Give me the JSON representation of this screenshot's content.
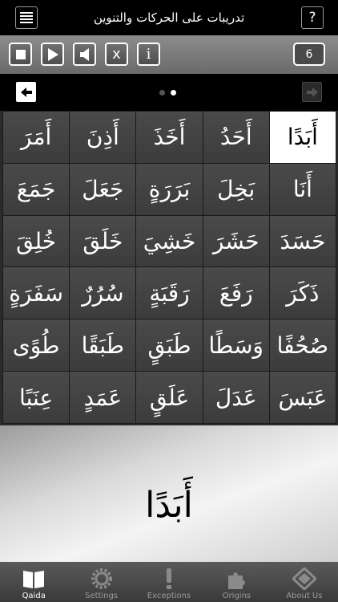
{
  "header": {
    "title": "تدريبات على الحركات والتنوين",
    "menu_icon": "menu-icon",
    "help_label": "?"
  },
  "toolbar": {
    "stop_icon": "stop-icon",
    "play_icon": "play-icon",
    "speaker_icon": "speaker-icon",
    "close_label": "x",
    "info_label": "i",
    "counter": "6"
  },
  "nav": {
    "prev_icon": "arrow-left-icon",
    "next_icon": "arrow-right-icon",
    "pages": 2,
    "current_page": 2
  },
  "grid": {
    "rows": [
      [
        "أَبَدًا",
        "أَحَدُ",
        "أَخَذَ",
        "أَذِنَ",
        "أَمَرَ"
      ],
      [
        "أَنَا",
        "بَخِلَ",
        "بَرَرَةٍ",
        "جَعَلَ",
        "جَمَعَ"
      ],
      [
        "حَسَدَ",
        "حَشَرَ",
        "خَشِيَ",
        "خَلَقَ",
        "خُلِقَ"
      ],
      [
        "ذَكَرَ",
        "رَفَعَ",
        "رَقَبَةٍ",
        "سُرُرٌ",
        "سَفَرَةٍ"
      ],
      [
        "صُحُفًا",
        "وَسَطًا",
        "طَبَقٍ",
        "طَبَقًا",
        "طُوًى"
      ],
      [
        "عَبَسَ",
        "عَدَلَ",
        "عَلَقٍ",
        "عَمَدٍ",
        "عِنَبًا"
      ]
    ],
    "selected": "أَبَدًا"
  },
  "display": {
    "word": "أَبَدًا"
  },
  "tabs": [
    {
      "label": "Qaida",
      "icon": "book-icon",
      "active": true
    },
    {
      "label": "Settings",
      "icon": "gear-icon",
      "active": false
    },
    {
      "label": "Exceptions",
      "icon": "exclamation-icon",
      "active": false
    },
    {
      "label": "Origins",
      "icon": "puzzle-icon",
      "active": false
    },
    {
      "label": "About Us",
      "icon": "diamond-icon",
      "active": false
    }
  ]
}
